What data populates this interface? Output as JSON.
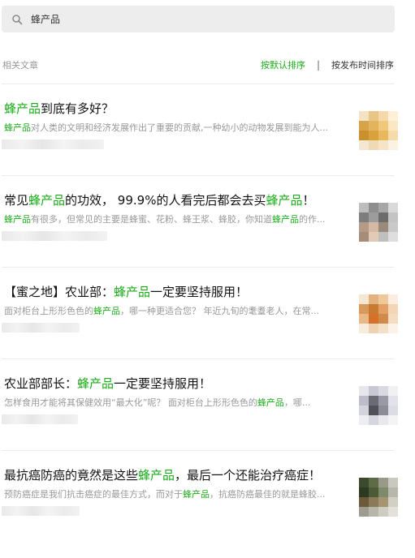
{
  "search": {
    "query": "蜂产品"
  },
  "toolbar": {
    "section_label": "相关文章",
    "sort_default": "按默认排序",
    "separator": "|",
    "sort_time": "按发布时间排序"
  },
  "colors": {
    "accent": "#1aad19",
    "muted": "#999999",
    "title": "#111111"
  },
  "articles": [
    {
      "title": [
        {
          "t": "蜂产品",
          "hl": true
        },
        {
          "t": "到底有多好？",
          "hl": false
        }
      ],
      "snippet": [
        {
          "t": "蜂产品",
          "hl": true
        },
        {
          "t": "对人类的文明和经济发展作出了重要的贡献,一种幼小的动物发展到能为人...",
          "hl": false
        }
      ]
    },
    {
      "title": [
        {
          "t": "常见",
          "hl": false
        },
        {
          "t": "蜂产品",
          "hl": true
        },
        {
          "t": "的功效， 99.9%的人看完后都会去买",
          "hl": false
        },
        {
          "t": "蜂产品",
          "hl": true
        },
        {
          "t": "！",
          "hl": false
        }
      ],
      "snippet": [
        {
          "t": "蜂产品",
          "hl": true
        },
        {
          "t": "有很多，但常见的主要是蜂蜜、花粉、蜂王浆、蜂胶，你知道",
          "hl": false
        },
        {
          "t": "蜂产品",
          "hl": true
        },
        {
          "t": "的作...",
          "hl": false
        }
      ]
    },
    {
      "title": [
        {
          "t": "【蜜之地】农业部：",
          "hl": false
        },
        {
          "t": "蜂产品",
          "hl": true
        },
        {
          "t": "一定要坚持服用！",
          "hl": false
        }
      ],
      "snippet": [
        {
          "t": "面对柜台上形形色色的",
          "hl": false
        },
        {
          "t": "蜂产品",
          "hl": true
        },
        {
          "t": "，哪一种更适合您？ 年近九旬的耄耋老人，在常...",
          "hl": false
        }
      ]
    },
    {
      "title": [
        {
          "t": "农业部部长：",
          "hl": false
        },
        {
          "t": "蜂产品",
          "hl": true
        },
        {
          "t": "一定要坚持服用！",
          "hl": false
        }
      ],
      "snippet": [
        {
          "t": "怎样食用才能将其保健效用“最大化”呢？ 面对柜台上形形色色的",
          "hl": false
        },
        {
          "t": "蜂产品",
          "hl": true
        },
        {
          "t": "，哪...",
          "hl": false
        }
      ]
    },
    {
      "title": [
        {
          "t": "最抗癌防癌的竟然是这些",
          "hl": false
        },
        {
          "t": "蜂产品",
          "hl": true
        },
        {
          "t": "，最后一个还能治疗癌症！",
          "hl": false
        }
      ],
      "snippet": [
        {
          "t": "预防癌症是我们抗击癌症的最佳方式，而对于",
          "hl": false
        },
        {
          "t": "蜂产品",
          "hl": true
        },
        {
          "t": "，抗癌防癌最佳的就是蜂胶...",
          "hl": false
        }
      ]
    }
  ]
}
